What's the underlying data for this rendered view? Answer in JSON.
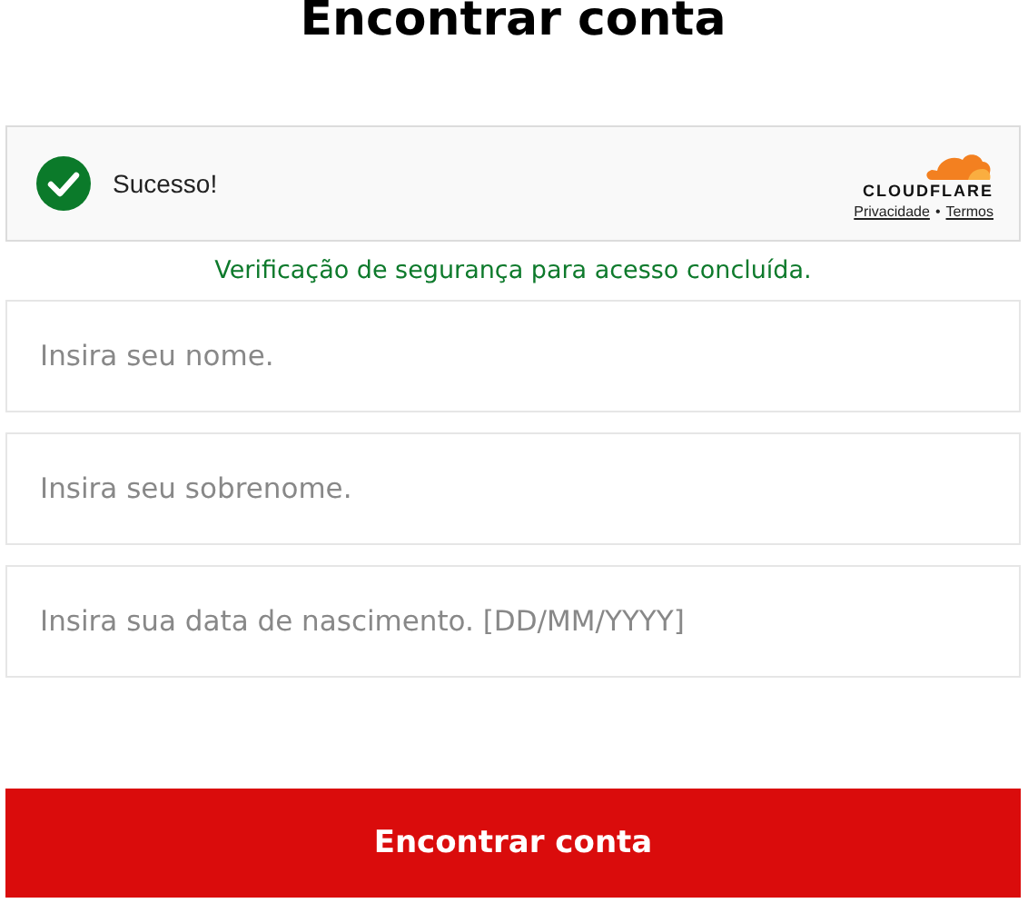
{
  "title": "Encontrar conta",
  "captcha": {
    "success": true,
    "status": "Sucesso!",
    "brand": "CLOUDFLARE",
    "links": [
      "Privacidade",
      "Termos"
    ],
    "separator": "•"
  },
  "message": "Verificação de segurança para acesso concluída.",
  "fields": [
    {
      "placeholder": "Insira seu nome."
    },
    {
      "placeholder": "Insira seu sobrenome."
    },
    {
      "placeholder": "Insira sua data de nascimento. [DD/MM/YYYY]"
    }
  ],
  "submit": "Encontrar conta"
}
